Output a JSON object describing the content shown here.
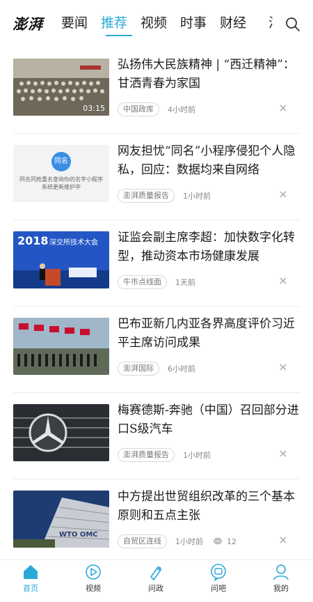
{
  "header": {
    "logo": "澎湃",
    "tabs": [
      {
        "label": "要闻",
        "active": false
      },
      {
        "label": "推荐",
        "active": true
      },
      {
        "label": "视频",
        "active": false
      },
      {
        "label": "时事",
        "active": false
      },
      {
        "label": "财经",
        "active": false
      }
    ],
    "more_tab_partial": "汽",
    "search_icon": "search-icon",
    "accent_color": "#2aa9d8"
  },
  "feed": [
    {
      "title": "弘扬伟大民族精神 | “西迁精神”：甘洒青春为家国",
      "tag": "中国政库",
      "time": "4小时前",
      "video_duration": "03:15"
    },
    {
      "title": "网友担忧“同名”小程序侵犯个人隐私，回应：数据均来自网络",
      "tag": "澎湃质量报告",
      "time": "1小时前",
      "thumb_badge": "同名",
      "thumb_caption": "同名同姓重名查询你的名字小程序系统更新维护中"
    },
    {
      "title": "证监会副主席李超：加快数字化转型，推动资本市场健康发展",
      "tag": "牛市点线面",
      "time": "1天前",
      "thumb_year": "2018",
      "thumb_banner": "深交所技术大会"
    },
    {
      "title": "巴布亚新几内亚各界高度评价习近平主席访问成果",
      "tag": "澎湃国际",
      "time": "6小时前"
    },
    {
      "title": "梅赛德斯-奔驰（中国）召回部分进口S级汽车",
      "tag": "澎湃质量报告",
      "time": "1小时前"
    },
    {
      "title": "中方提出世贸组织改革的三个基本原则和五点主张",
      "tag": "自贸区连线",
      "time": "1小时前",
      "comments": "12",
      "thumb_sign": "WTO OMC"
    }
  ],
  "bottom_nav": [
    {
      "label": "首页",
      "icon": "home-icon",
      "active": true
    },
    {
      "label": "视频",
      "icon": "play-icon",
      "active": false
    },
    {
      "label": "问政",
      "icon": "pen-icon",
      "active": false
    },
    {
      "label": "问吧",
      "icon": "ask-icon",
      "active": false
    },
    {
      "label": "我的",
      "icon": "profile-icon",
      "active": false
    }
  ]
}
